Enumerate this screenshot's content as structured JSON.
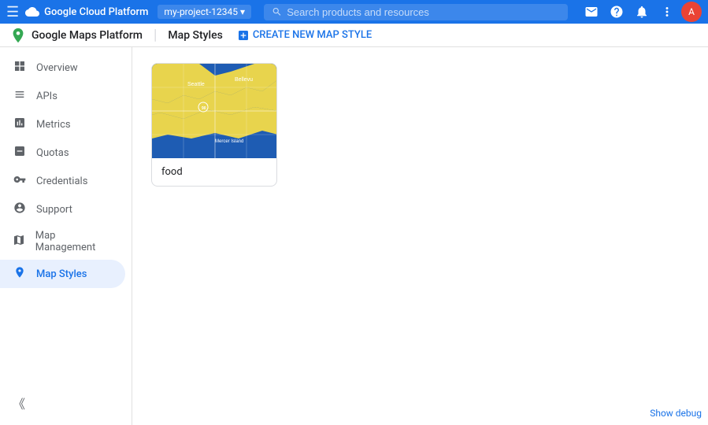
{
  "topBar": {
    "menuIcon": "☰",
    "title": "Google Cloud Platform",
    "project": "my-project-12345",
    "searchPlaceholder": "Search products and resources",
    "dropdownIcon": "▾",
    "emailIcon": "✉",
    "helpIcon": "?",
    "notificationIcon": "🔔",
    "moreIcon": "⋮",
    "avatarLabel": "A"
  },
  "subHeader": {
    "appName": "Google Maps Platform",
    "currentPage": "Map Styles",
    "createButtonLabel": "CREATE NEW MAP STYLE",
    "createIcon": "+"
  },
  "sidebar": {
    "items": [
      {
        "id": "overview",
        "label": "Overview",
        "icon": "⊞",
        "active": false
      },
      {
        "id": "apis",
        "label": "APIs",
        "icon": "≡",
        "active": false
      },
      {
        "id": "metrics",
        "label": "Metrics",
        "icon": "▦",
        "active": false
      },
      {
        "id": "quotas",
        "label": "Quotas",
        "icon": "☐",
        "active": false
      },
      {
        "id": "credentials",
        "label": "Credentials",
        "icon": "🔑",
        "active": false
      },
      {
        "id": "support",
        "label": "Support",
        "icon": "👤",
        "active": false
      },
      {
        "id": "map-management",
        "label": "Map Management",
        "icon": "⊟",
        "active": false
      },
      {
        "id": "map-styles",
        "label": "Map Styles",
        "icon": "◎",
        "active": true
      }
    ],
    "collapseIcon": "《"
  },
  "main": {
    "mapStyles": [
      {
        "id": "food",
        "label": "food",
        "hasPreview": true
      }
    ]
  },
  "footer": {
    "showDebugLabel": "Show debug"
  }
}
